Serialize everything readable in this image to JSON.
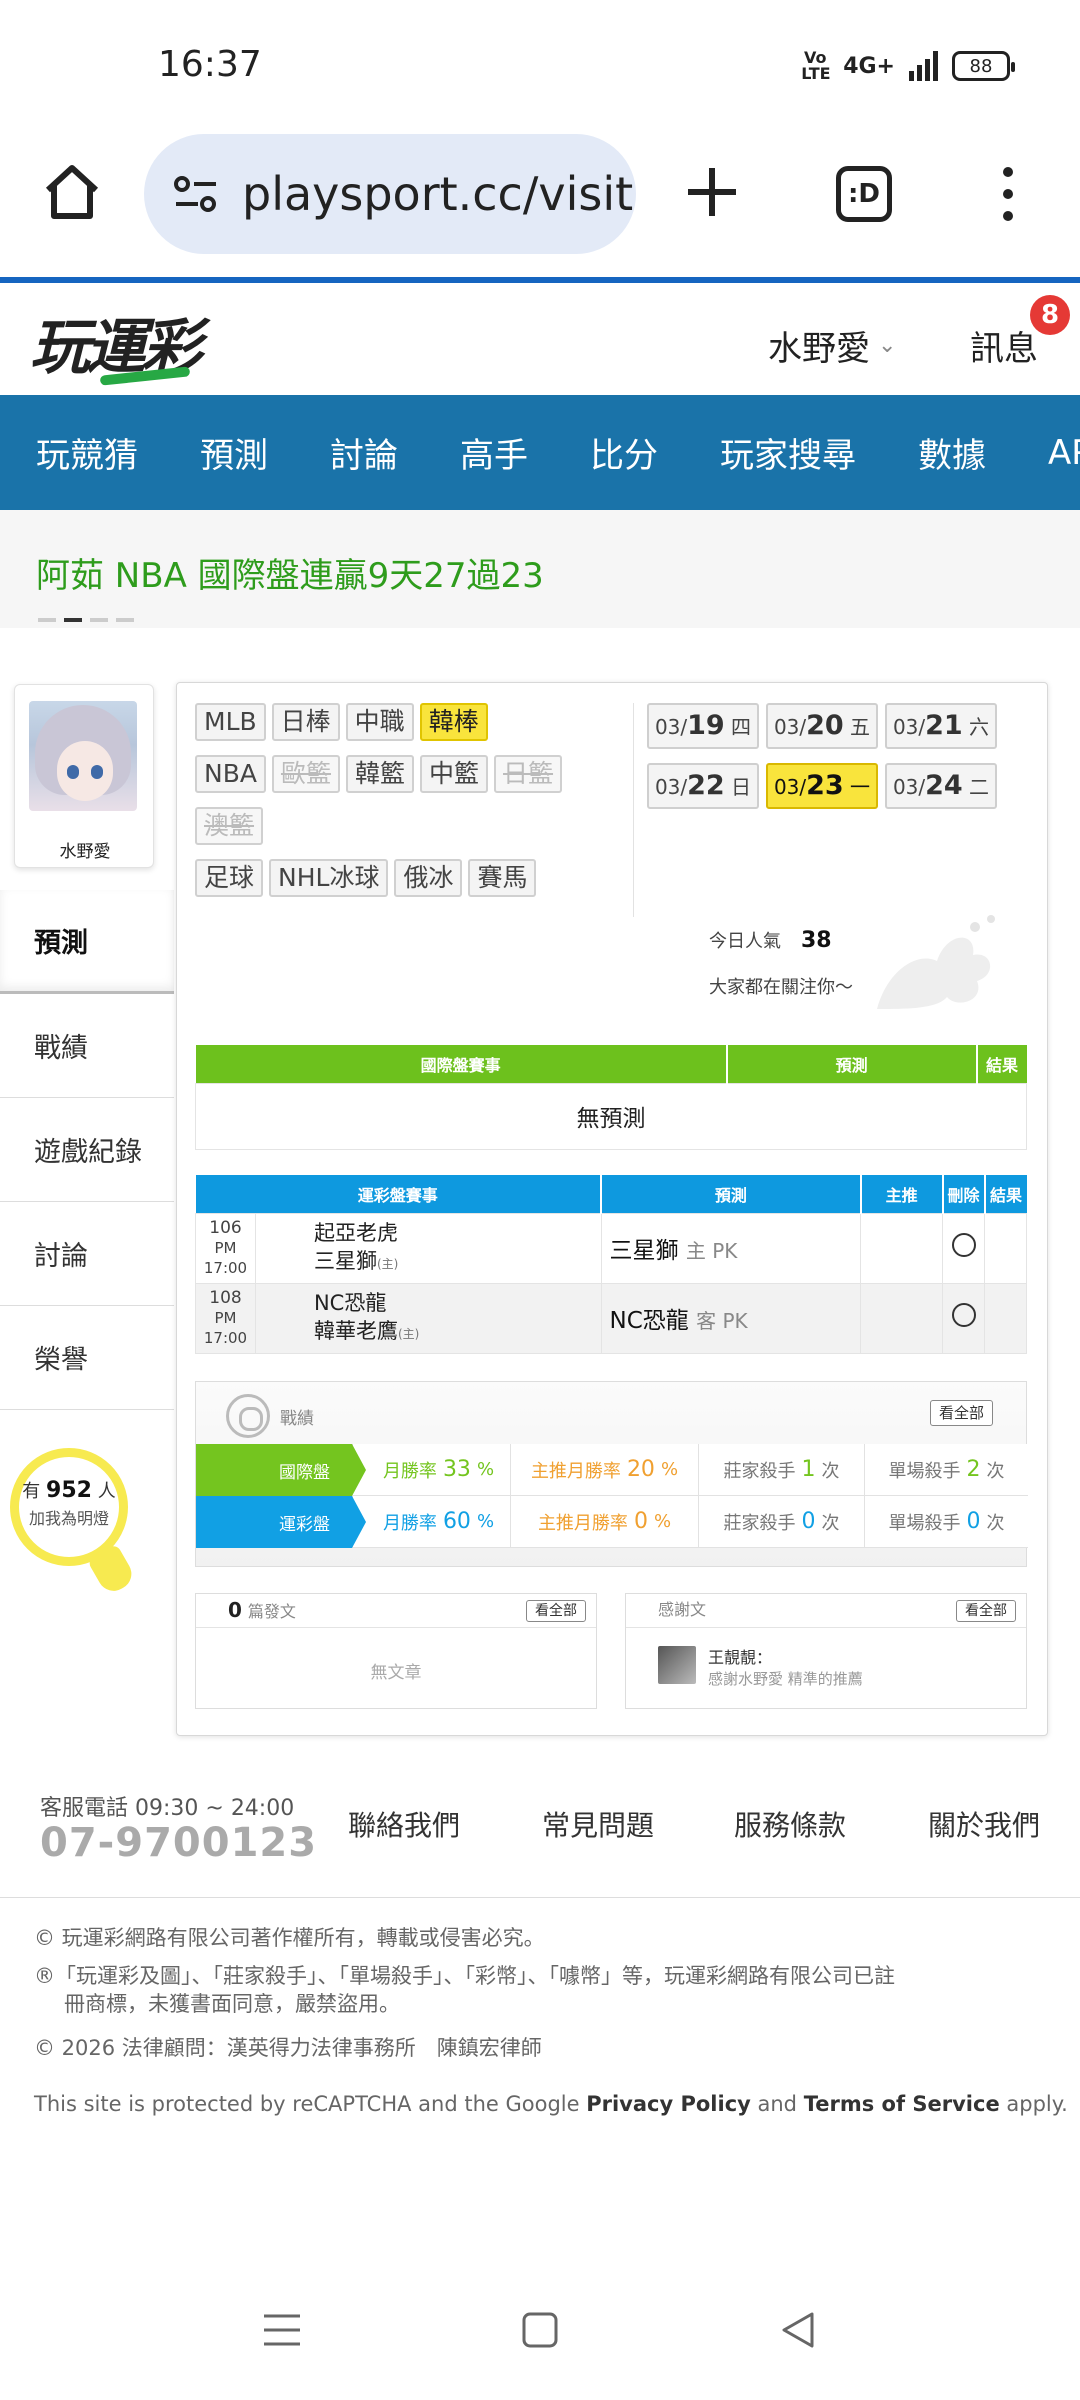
{
  "status": {
    "time": "16:37",
    "volte": "Vo LTE",
    "network": "4G+",
    "battery": "88"
  },
  "browser": {
    "url": "playsport.cc/visit",
    "tabs_label": ":D"
  },
  "header": {
    "logo": "玩運彩",
    "user": "水野愛",
    "messages_label": "訊息",
    "messages_count": "8"
  },
  "nav": {
    "items": [
      "玩競猜",
      "預測",
      "討論",
      "高手",
      "比分",
      "玩家搜尋",
      "數據",
      "APP"
    ]
  },
  "marquee": {
    "text": "阿茹  NBA 國際盤連贏9天27過23"
  },
  "profile": {
    "name": "水野愛"
  },
  "side_menu": {
    "items": [
      "預測",
      "戰績",
      "遊戲紀錄",
      "討論",
      "榮譽"
    ]
  },
  "fans": {
    "prefix": "有",
    "count": "952",
    "suffix": "人",
    "line2": "加我為明燈"
  },
  "leagues": [
    {
      "label": "MLB",
      "state": "normal"
    },
    {
      "label": "日棒",
      "state": "normal"
    },
    {
      "label": "中職",
      "state": "normal"
    },
    {
      "label": "韓棒",
      "state": "active"
    },
    {
      "label": "NBA",
      "state": "normal"
    },
    {
      "label": "歐籃",
      "state": "disabled"
    },
    {
      "label": "韓籃",
      "state": "normal"
    },
    {
      "label": "中籃",
      "state": "normal"
    },
    {
      "label": "日籃",
      "state": "disabled"
    },
    {
      "label": "澳籃",
      "state": "disabled"
    },
    {
      "label": "足球",
      "state": "normal"
    },
    {
      "label": "NHL冰球",
      "state": "normal"
    },
    {
      "label": "俄冰",
      "state": "normal"
    },
    {
      "label": "賽馬",
      "state": "normal"
    }
  ],
  "dates": [
    {
      "month": "03/",
      "day": "19",
      "weekday": " 四",
      "active": false
    },
    {
      "month": "03/",
      "day": "20",
      "weekday": " 五",
      "active": false
    },
    {
      "month": "03/",
      "day": "21",
      "weekday": " 六",
      "active": false
    },
    {
      "month": "03/",
      "day": "22",
      "weekday": " 日",
      "active": false
    },
    {
      "month": "03/",
      "day": "23",
      "weekday": " 一",
      "active": true
    },
    {
      "month": "03/",
      "day": "24",
      "weekday": " 二",
      "active": false
    }
  ],
  "popularity": {
    "label": "今日人氣",
    "value": "38",
    "follow": "大家都在關注你～"
  },
  "intl_table": {
    "headers": [
      "國際盤賽事",
      "預測",
      "結果"
    ],
    "empty": "無預測"
  },
  "lottery_table": {
    "headers": [
      "運彩盤賽事",
      "預測",
      "主推",
      "刪除",
      "結果"
    ],
    "rows": [
      {
        "code": "106",
        "time": "PM 17:00",
        "away": "起亞老虎",
        "home": "三星獅",
        "home_tag": "(主)",
        "pick": "三星獅",
        "pick_tag": "主 PK"
      },
      {
        "code": "108",
        "time": "PM 17:00",
        "away": "NC恐龍",
        "home": "韓華老鷹",
        "home_tag": "(主)",
        "pick": "NC恐龍",
        "pick_tag": "客 PK"
      }
    ]
  },
  "record": {
    "title": "戰績",
    "view_all": "看全部",
    "rows": [
      {
        "label": "國際盤",
        "win_label": "月勝率",
        "win": "33",
        "main_label": "主推月勝率",
        "main": "20",
        "dealer_label": "莊家殺手",
        "dealer": "1",
        "single_label": "單場殺手",
        "single": "2",
        "pct": "%",
        "times": "次"
      },
      {
        "label": "運彩盤",
        "win_label": "月勝率",
        "win": "60",
        "main_label": "主推月勝率",
        "main": "0",
        "dealer_label": "莊家殺手",
        "dealer": "0",
        "single_label": "單場殺手",
        "single": "0",
        "pct": "%",
        "times": "次"
      }
    ]
  },
  "posts": {
    "count": "0",
    "label": "篇發文",
    "view_all": "看全部",
    "empty": "無文章"
  },
  "thanks": {
    "title": "感謝文",
    "view_all": "看全部",
    "name": "王靚靚：",
    "text": "感謝水野愛 精準的推薦"
  },
  "footer": {
    "tel_label": "客服電話 09:30 ~ 24:00",
    "tel": "07-9700123",
    "links": [
      "聯絡我們",
      "常見問題",
      "服務條款",
      "關於我們"
    ],
    "copyright": "© 玩運彩網路有限公司著作權所有，轉載或侵害必究。",
    "trademark_1": "®「玩運彩及圖」、「莊家殺手」、「單場殺手」、「彩幣」、「噱幣」等，玩運彩網路有限公司已註",
    "trademark_2": "冊商標，未獲書面同意，嚴禁盜用。",
    "counsel": "© 2026 法律顧問：漢英得力法律事務所　陳鎮宏律師",
    "recaptcha_1": "This site is protected by reCAPTCHA and the Google ",
    "privacy": "Privacy Policy",
    "and": " and ",
    "terms": "Terms of Service",
    "apply": " apply."
  },
  "colors": {
    "nav_blue": "#1a73a9",
    "intl_green": "#6dc11d",
    "lottery_blue": "#0e99df",
    "active_yellow": "#f9e43c",
    "marquee_green": "#2e9c1c"
  }
}
